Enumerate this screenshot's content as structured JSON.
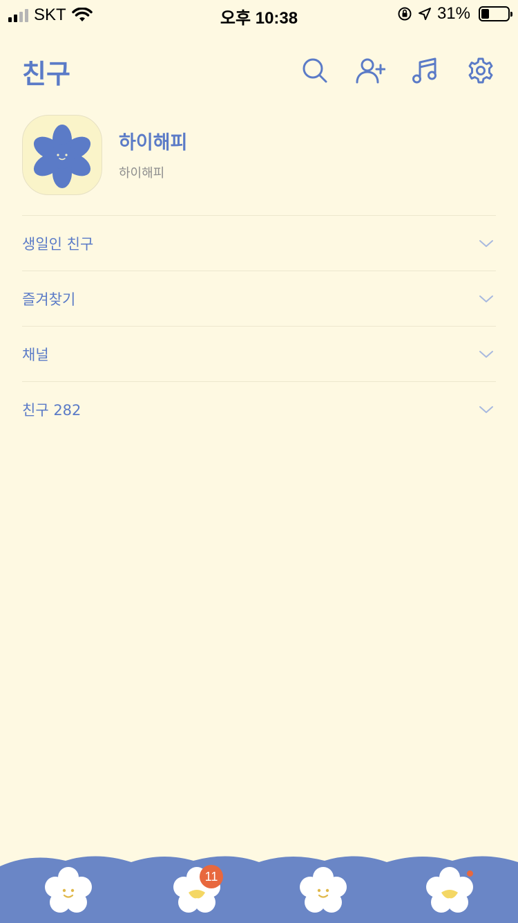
{
  "status_bar": {
    "carrier": "SKT",
    "time": "오후 10:38",
    "battery_percent": "31%",
    "battery_level": 0.31,
    "icons": [
      "signal-icon",
      "wifi-icon",
      "rotation-lock-icon",
      "location-icon",
      "battery-icon"
    ]
  },
  "header": {
    "title": "친구",
    "icons": [
      "search-icon",
      "add-friend-icon",
      "music-icon",
      "settings-icon"
    ]
  },
  "profile": {
    "name": "하이해피",
    "status": "하이해피",
    "avatar_icon": "blue-flower-icon"
  },
  "sections": [
    {
      "label": "생일인 친구"
    },
    {
      "label": "즐겨찾기"
    },
    {
      "label": "채널"
    },
    {
      "label": "친구 282"
    }
  ],
  "tabbar": {
    "tabs": [
      {
        "name": "friends",
        "icon": "flower-icon"
      },
      {
        "name": "chats",
        "icon": "flower-icon",
        "badge": "11"
      },
      {
        "name": "view",
        "icon": "flower-icon"
      },
      {
        "name": "more",
        "icon": "flower-icon",
        "dot": true
      }
    ]
  },
  "colors": {
    "background": "#FEF9E2",
    "accent": "#5B7BC7",
    "tabbar": "#6A86C6",
    "badge": "#E8683E"
  }
}
